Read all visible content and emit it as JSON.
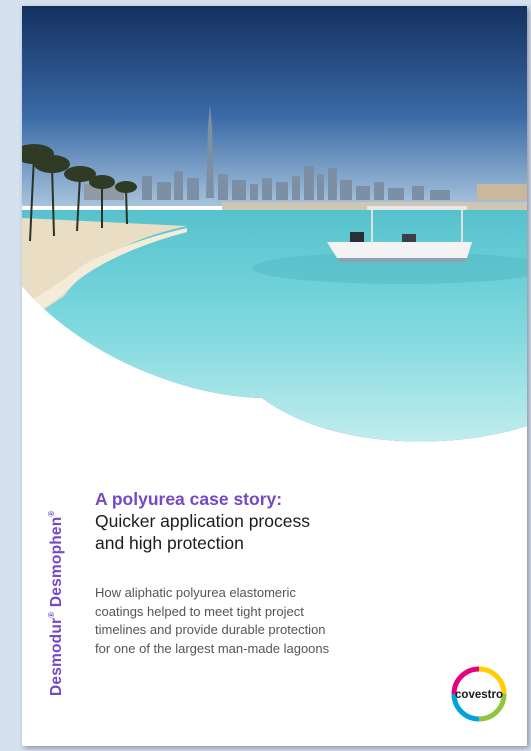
{
  "side_brand": {
    "part1": "Desmodur",
    "part2": "Desmophen",
    "mark": "®"
  },
  "title": {
    "line1": "A polyurea case story:",
    "line2": "Quicker application process",
    "line3": "and high protection"
  },
  "body": {
    "line1": "How aliphatic polyurea elastomeric",
    "line2": "coatings helped to meet tight project",
    "line3": "timelines and provide durable protection",
    "line4": "for one of the largest man-made lagoons"
  },
  "logo": {
    "text": "covestro"
  },
  "colors": {
    "brand_purple": "#7548c6",
    "background": "#d5e1ee"
  }
}
